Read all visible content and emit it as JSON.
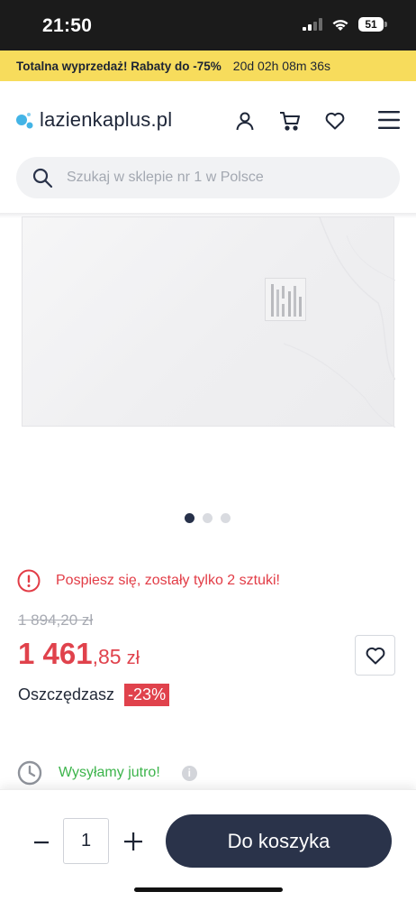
{
  "status_bar": {
    "time": "21:50",
    "battery": "51"
  },
  "promo": {
    "text": "Totalna wyprzedaż! Rabaty do -75%",
    "timer": "20d 02h 08m 36s"
  },
  "header": {
    "logo": "lazienkaplus.pl",
    "icons": [
      "user-icon",
      "cart-icon",
      "heart-icon",
      "menu-icon"
    ]
  },
  "search": {
    "placeholder": "Szukaj w sklepie nr 1 w Polsce"
  },
  "gallery": {
    "slides": 3,
    "active_slide": 1
  },
  "product": {
    "stock_warning": "Pospiesz się, zostały tylko 2 sztuki!",
    "old_price": "1 894,20 zł",
    "price_main": "1 461",
    "price_cents": ",85",
    "price_currency": "zł",
    "savings_label": "Oszczędzasz",
    "discount": "-23%",
    "shipping": "Wysyłamy jutro!",
    "info_icon": "i"
  },
  "cart": {
    "quantity": "1",
    "add_label": "Do koszyka",
    "minus": "−",
    "plus": "+"
  },
  "colors": {
    "accent": "#e0424c",
    "dark": "#2a334a",
    "promo_bg": "#f7dc5c",
    "success": "#3cb44b"
  }
}
